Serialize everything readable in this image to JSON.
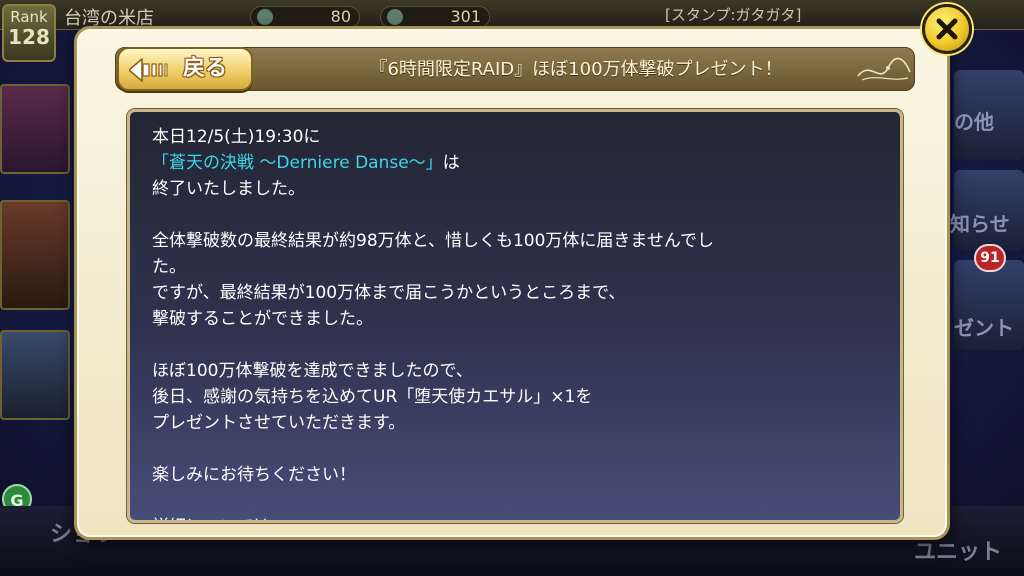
{
  "background": {
    "rank_label": "Rank",
    "rank_value": "128",
    "shop_name": "台湾の米店",
    "stat_1": "80",
    "stat_2": "301",
    "stamp_label": "[スタンプ:ガタガタ]",
    "badge_count": "91",
    "right_text_1": "の他",
    "right_text_2": "知らせ",
    "right_text_3": "ゼント",
    "bottom_text_1": "ショウ",
    "bottom_text_2": "ユニット",
    "g_badge": "G"
  },
  "dialog": {
    "back_label": "戻る",
    "title": "『6時間限定RAID』ほぼ100万体撃破プレゼント！",
    "content": {
      "line_1": "本日12/5(土)19:30に",
      "event_name": "「蒼天の決戦 〜Derniere Danse〜」",
      "line_2_suffix": "は",
      "line_3": "終了いたしました。",
      "line_4": "全体撃破数の最終結果が約98万体と、惜しくも100万体に届きませんでし",
      "line_5": "た。",
      "line_6": "ですが、最終結果が100万体まで届こうかというところまで、",
      "line_7": "撃破することができました。",
      "line_8": "ほぼ100万体撃破を達成できましたので、",
      "line_9": "後日、感謝の気持ちを込めてUR「堕天使カエサル」×1を",
      "line_10": "プレゼントさせていただきます。",
      "line_11": "楽しみにお待ちください！",
      "line_12": "詳細については、"
    }
  },
  "icons": {
    "back": "left-arrow-icon",
    "close": "close-icon"
  },
  "colors": {
    "event_name": "#3ad7e8",
    "panel_bg": "#2f3350",
    "dialog_bg": "#fbf6e3",
    "header_bg": "#7d6a42",
    "close_button": "#f0c82a"
  }
}
